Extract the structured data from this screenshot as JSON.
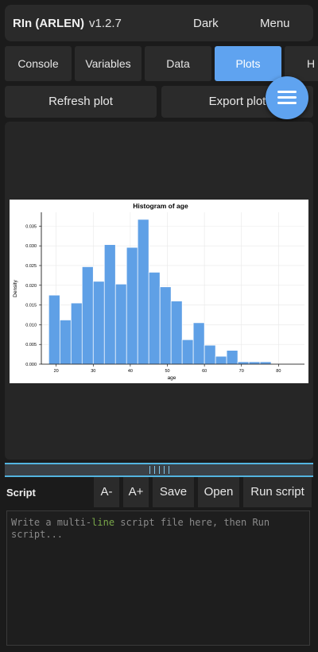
{
  "app": {
    "title": "RIn (ARLEN)",
    "version": "v1.2.7"
  },
  "topbar": {
    "theme_label": "Dark",
    "menu_label": "Menu"
  },
  "tabs": [
    {
      "label": "Console",
      "active": false
    },
    {
      "label": "Variables",
      "active": false
    },
    {
      "label": "Data",
      "active": false
    },
    {
      "label": "Plots",
      "active": true
    },
    {
      "label": "H",
      "active": false
    }
  ],
  "plot_actions": {
    "refresh_label": "Refresh plot",
    "export_label": "Export plot"
  },
  "fab": {
    "icon": "hamburger-menu-icon"
  },
  "chart_data": {
    "type": "bar",
    "title": "Histogram of age",
    "xlabel": "age",
    "ylabel": "Density",
    "bin_edges": [
      18,
      21,
      24,
      27,
      30,
      33,
      36,
      39,
      42,
      45,
      48,
      51,
      54,
      57,
      60,
      63,
      66,
      69,
      72,
      75,
      78,
      81,
      84,
      87
    ],
    "values": [
      0.0175,
      0.0112,
      0.0155,
      0.0247,
      0.021,
      0.0303,
      0.0203,
      0.0296,
      0.0367,
      0.0233,
      0.0196,
      0.016,
      0.0062,
      0.0105,
      0.0048,
      0.002,
      0.0035,
      0.0006,
      0.0006,
      0.0006,
      0.0,
      0.0,
      0.0
    ],
    "xticks": [
      20,
      30,
      40,
      50,
      60,
      70,
      80
    ],
    "yticks": [
      "0.000",
      "0.005",
      "0.010",
      "0.015",
      "0.020",
      "0.025",
      "0.030",
      "0.035"
    ],
    "xlim": [
      16,
      87
    ],
    "ylim": [
      0,
      0.0385
    ],
    "grid": true,
    "bar_color": "#5fa0e6"
  },
  "script": {
    "label": "Script",
    "font_decrease": "A-",
    "font_increase": "A+",
    "save_label": "Save",
    "open_label": "Open",
    "run_label": "Run script",
    "placeholder_before": "Write a multi-",
    "placeholder_keyword": "line",
    "placeholder_after": " script file here, then Run script..."
  },
  "colors": {
    "accent": "#5fa3f0",
    "splitter": "#53b4e0",
    "background": "#1b1b1b"
  }
}
